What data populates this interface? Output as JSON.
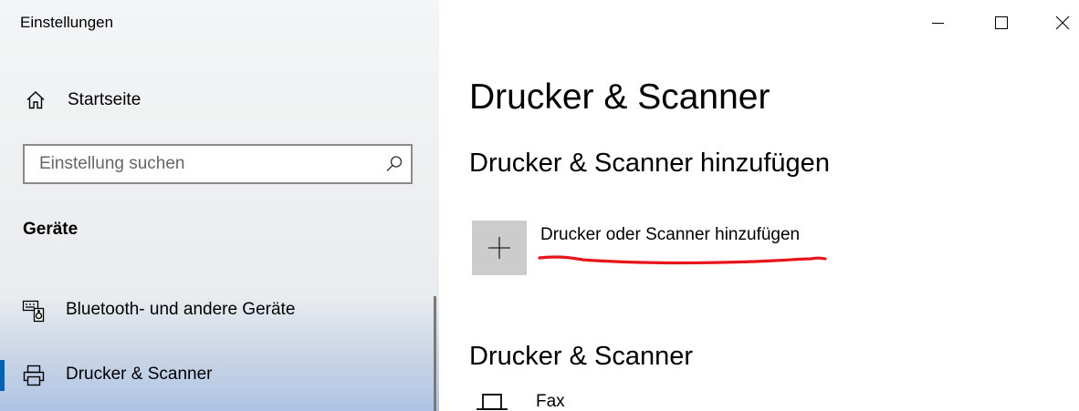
{
  "window": {
    "title": "Einstellungen"
  },
  "sidebar": {
    "home_label": "Startseite",
    "home_icon": "home-icon",
    "search_placeholder": "Einstellung suchen",
    "search_value": "",
    "search_icon": "search-icon",
    "section_title": "Geräte",
    "items": [
      {
        "label": "Bluetooth- und andere Geräte",
        "icon": "bluetooth-devices-icon",
        "selected": false
      },
      {
        "label": "Drucker & Scanner",
        "icon": "printer-icon",
        "selected": true
      }
    ],
    "accent_color": "#0063b1"
  },
  "main": {
    "page_title": "Drucker & Scanner",
    "add_section_title": "Drucker & Scanner hinzufügen",
    "add_button_label": "Drucker oder Scanner hinzufügen",
    "add_icon": "plus-icon",
    "list_section_title": "Drucker & Scanner",
    "devices": [
      {
        "label": "Fax",
        "icon": "fax-printer-icon"
      }
    ],
    "annotation_color": "#e8141a"
  },
  "controls": {
    "minimize": "minimize-icon",
    "maximize": "maximize-icon",
    "close": "close-icon"
  }
}
